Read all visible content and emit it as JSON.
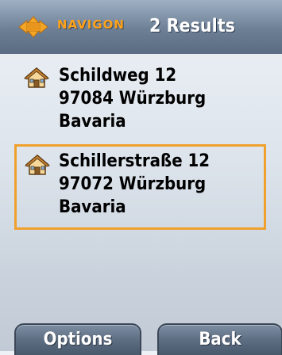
{
  "header": {
    "brand": "NAVIGON",
    "results_label": "2 Results"
  },
  "results": [
    {
      "icon": "home-icon",
      "street": "Schildweg 12",
      "city": "97084 Würzburg",
      "region": "Bavaria",
      "selected": false
    },
    {
      "icon": "home-icon",
      "street": "Schillerstraße 12",
      "city": "97072 Würzburg",
      "region": "Bavaria",
      "selected": true
    }
  ],
  "softkeys": {
    "left_label": "Options",
    "right_label": "Back"
  },
  "colors": {
    "accent": "#f0a02c",
    "brand": "#ffa21a",
    "header": "#6c7f95",
    "softkey": "#5d6d82"
  }
}
